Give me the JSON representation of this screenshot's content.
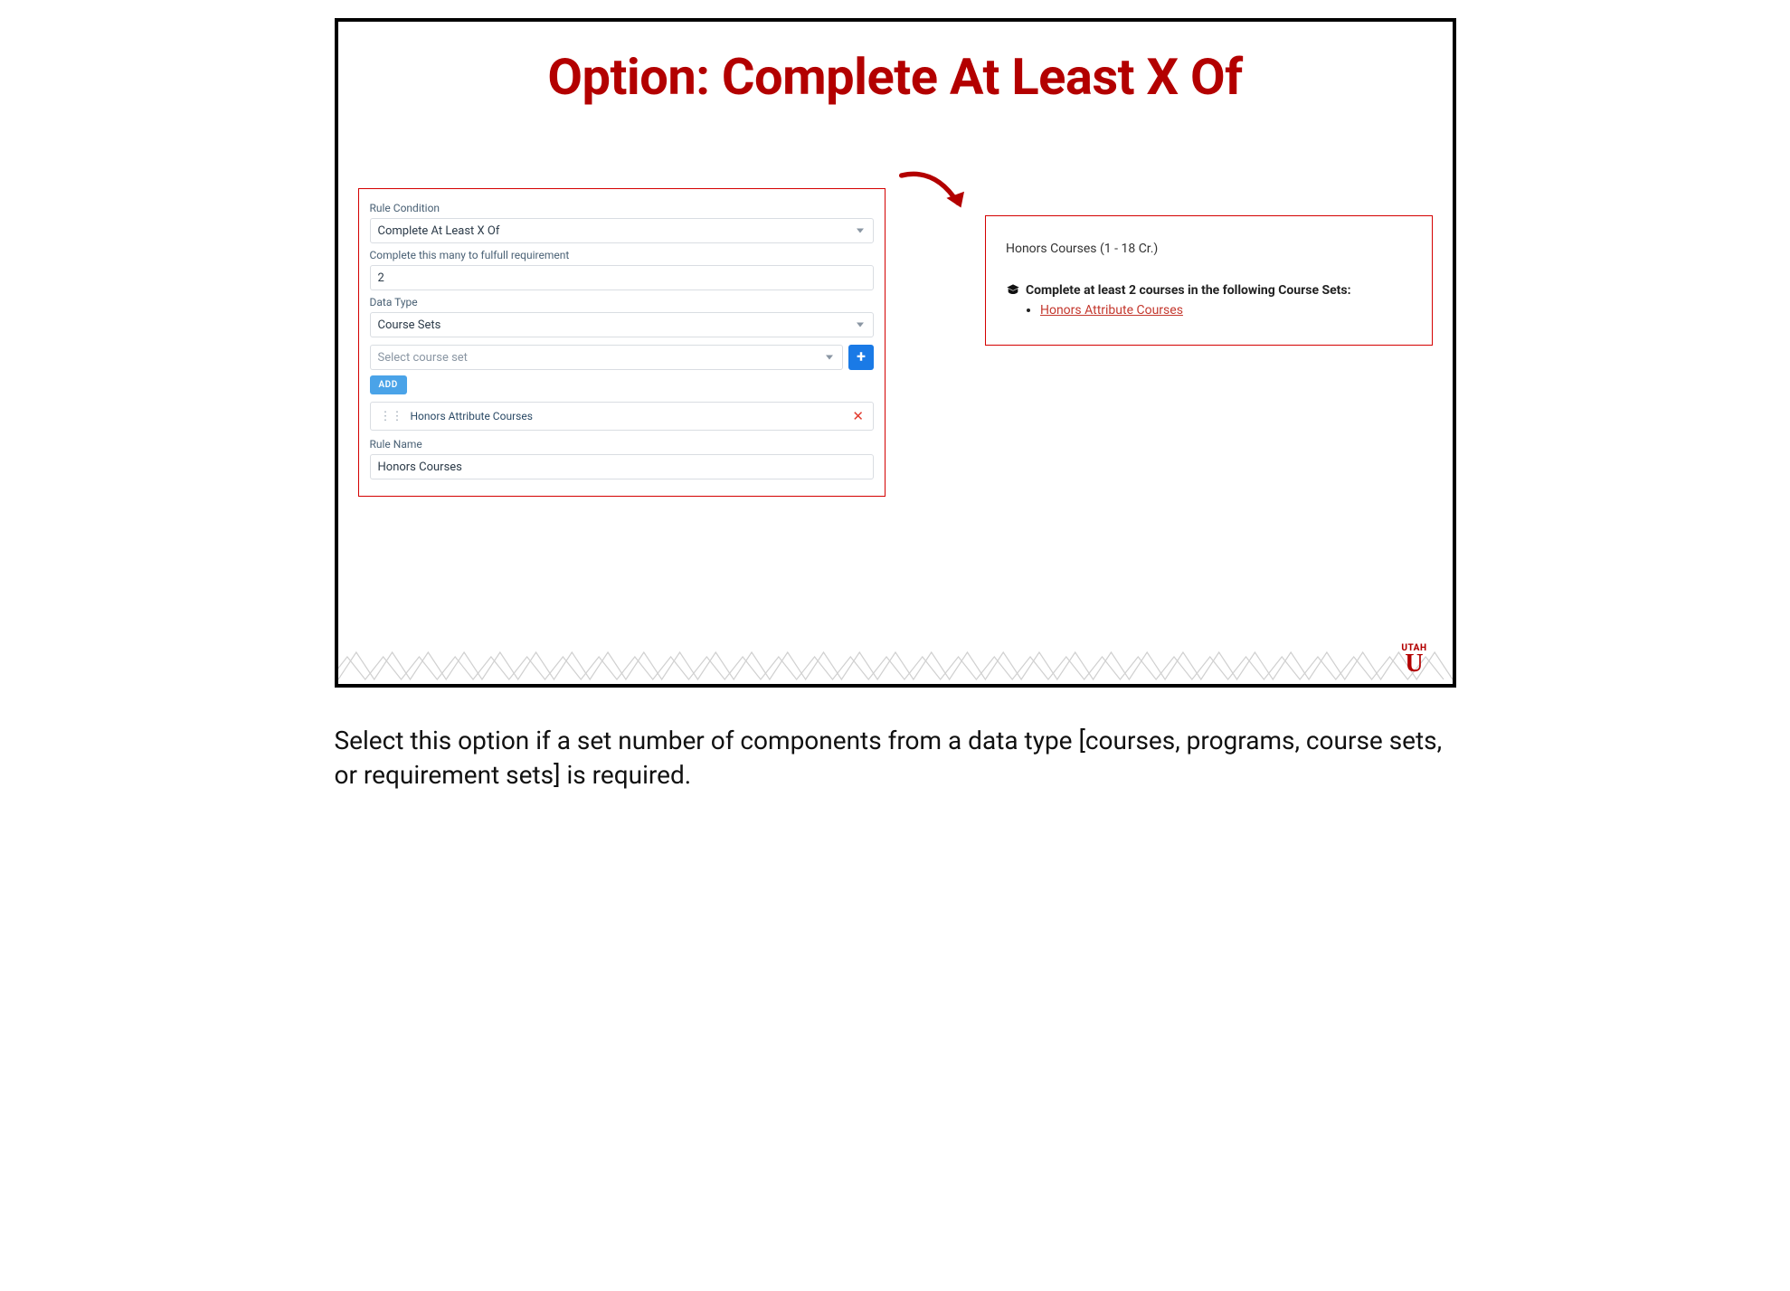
{
  "slide": {
    "title": "Option: Complete At Least X Of"
  },
  "form": {
    "rule_condition_label": "Rule Condition",
    "rule_condition_value": "Complete At Least X Of",
    "complete_many_label": "Complete this many to fulfull requirement",
    "complete_many_value": "2",
    "data_type_label": "Data Type",
    "data_type_value": "Course Sets",
    "select_course_set_placeholder": "Select course set",
    "add_button": "ADD",
    "added_item": "Honors Attribute Courses",
    "rule_name_label": "Rule Name",
    "rule_name_value": "Honors Courses"
  },
  "preview": {
    "heading": "Honors Courses (1 - 18 Cr.)",
    "rule_text": "Complete at least 2 courses in the following Course Sets:",
    "link_text": "Honors Attribute Courses"
  },
  "logo": {
    "top": "UTAH",
    "letter": "U"
  },
  "caption": "Select this option if a set number of components from a data type [courses, programs, course sets, or requirement sets] is required."
}
